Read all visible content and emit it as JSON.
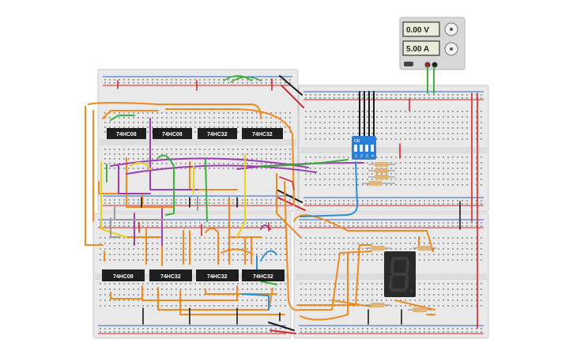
{
  "power_supply": {
    "voltage_display": "0.00 V",
    "current_display": "5.00 A"
  },
  "chips_top": [
    "74HC08",
    "74HC08",
    "74HC32",
    "74HC32"
  ],
  "chips_bottom": [
    "74HC08",
    "74HC32",
    "74HC32",
    "74HC32"
  ],
  "dip_switch": {
    "label": "ON",
    "positions": [
      "1",
      "2",
      "3",
      "4"
    ]
  },
  "seven_segment": {
    "digit": "8"
  },
  "colors": {
    "breadboard": "#e9e9e9",
    "chip": "#1e1e1e",
    "wire_orange": "#f08a1e",
    "wire_purple": "#9b3fb0",
    "wire_green": "#3fae3a",
    "wire_yellow": "#e6d21c",
    "wire_blue": "#2a8fd8",
    "wire_gray": "#9a9a9a",
    "wire_red": "#d62828",
    "wire_black": "#1a1a1a",
    "dip_switch": "#2a7fd8",
    "display": "#2a2a2a"
  }
}
